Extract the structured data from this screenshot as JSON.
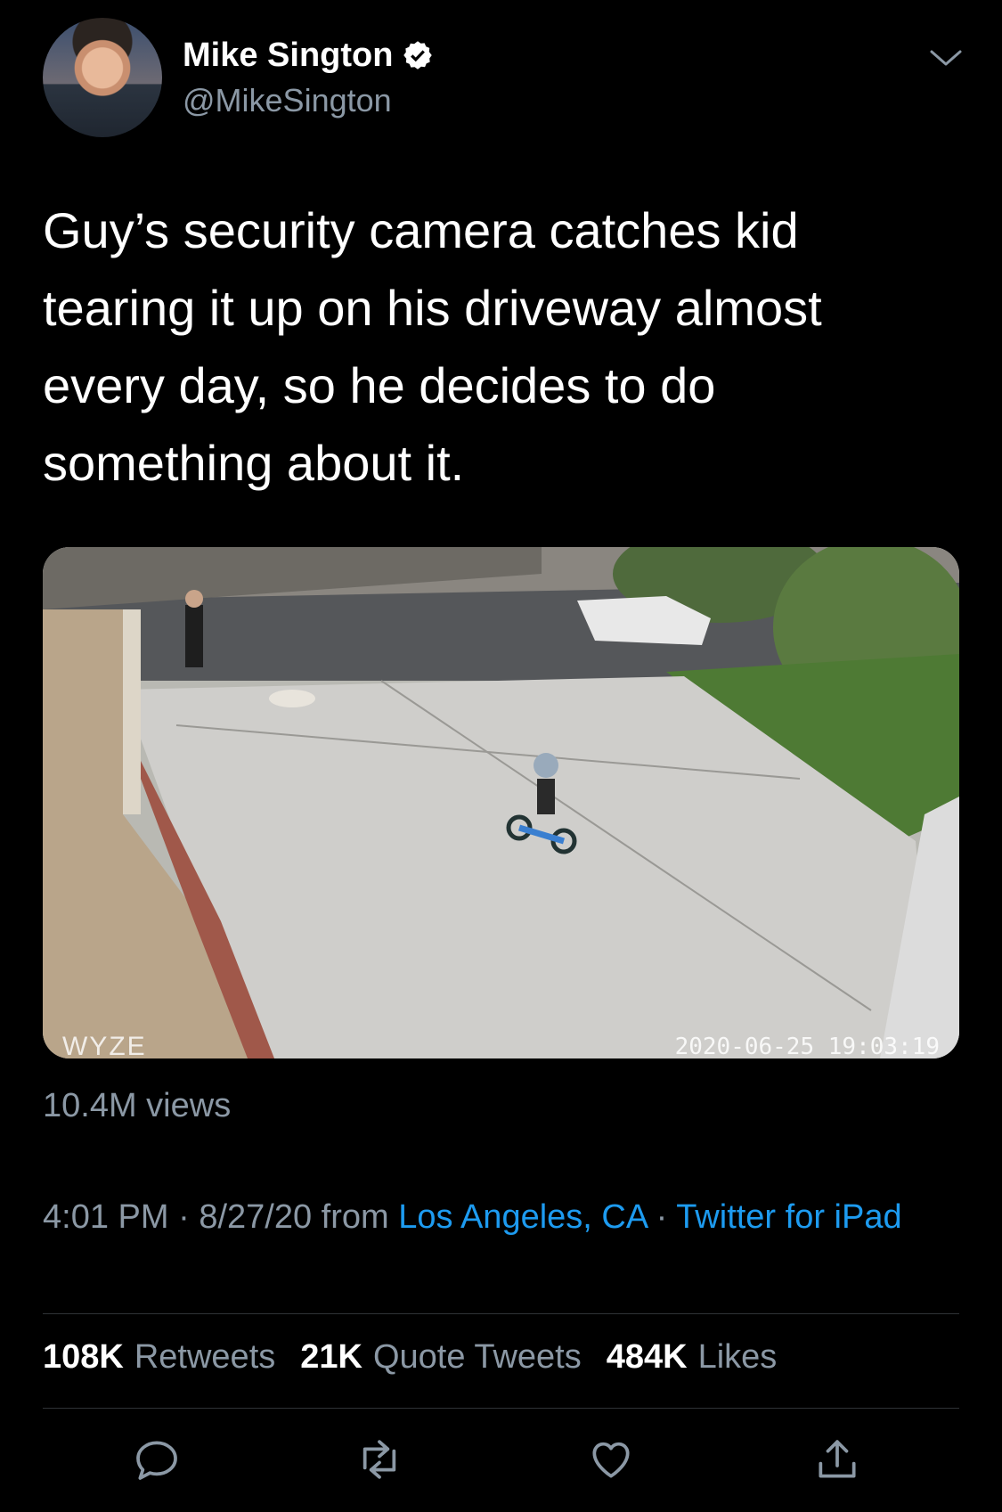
{
  "author": {
    "name": "Mike Sington",
    "handle": "@MikeSington",
    "verified": true
  },
  "tweet": {
    "text": "Guy’s security camera catches kid tearing it up on his driveway almost every day, so he decides to do something about it.",
    "media": {
      "watermark": "WYZE",
      "timestamp": "2020-06-25  19:03:19"
    },
    "views": "10.4M views",
    "time": "4:01 PM",
    "date": "8/27/20",
    "from_label": "from",
    "location": "Los Angeles, CA",
    "client": "Twitter for iPad"
  },
  "stats": {
    "retweets_count": "108K",
    "retweets_label": "Retweets",
    "quotes_count": "21K",
    "quotes_label": "Quote Tweets",
    "likes_count": "484K",
    "likes_label": "Likes"
  },
  "colors": {
    "background": "#000000",
    "text_primary": "#ffffff",
    "text_secondary": "#8b98a5",
    "link": "#1d9bf0",
    "divider": "#2f3336"
  },
  "icons": [
    "verified-badge-icon",
    "chevron-down-icon",
    "reply-icon",
    "retweet-icon",
    "like-icon",
    "share-icon"
  ]
}
